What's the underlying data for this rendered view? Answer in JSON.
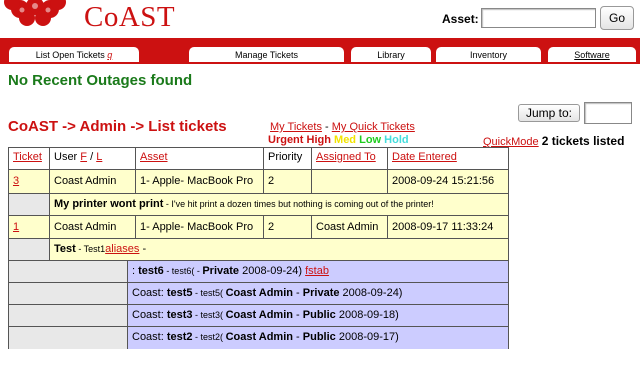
{
  "app": {
    "title": "CoAST",
    "logo": "flower-logo"
  },
  "asset_search": {
    "label": "Asset:",
    "value": "",
    "go_label": "Go"
  },
  "nav": {
    "tabs": [
      {
        "label": "List Open Tickets",
        "hotkey": "q"
      },
      {
        "label": "Manage Tickets"
      },
      {
        "label": "Library"
      },
      {
        "label": "Inventory"
      },
      {
        "label": "Software"
      }
    ]
  },
  "outages_text": "No Recent Outages found",
  "jump": {
    "label": "Jump to:",
    "value": ""
  },
  "breadcrumb": "CoAST -> Admin -> List tickets",
  "links": {
    "my_tickets": "My Tickets",
    "separator": " - ",
    "my_quick_tickets": "My Quick Tickets"
  },
  "priority_legend": {
    "urgent": "Urgent",
    "high": "High",
    "med": "Med",
    "low": "Low",
    "hold": "Hold"
  },
  "quickmode": {
    "label": "QuickMode",
    "count_text": "2 tickets listed"
  },
  "table": {
    "headers": {
      "ticket": "Ticket",
      "user": "User",
      "user_f": "F",
      "user_sep": " / ",
      "user_l": "L",
      "asset": "Asset",
      "priority": "Priority",
      "assigned_to": "Assigned To",
      "date_entered": "Date Entered"
    },
    "tickets": [
      {
        "id": "3",
        "user": "Coast Admin",
        "asset": "1- Apple- MacBook Pro",
        "priority": "2",
        "assigned_to": "",
        "date": "2008-09-24 15:21:56",
        "title": "My printer wont print",
        "description": " - I've hit print a dozen times but nothing is coming out of the printer!"
      },
      {
        "id": "1",
        "user": "Coast Admin",
        "asset": "1- Apple- MacBook Pro",
        "priority": "2",
        "assigned_to": "Coast Admin",
        "date": "2008-09-17 11:33:24",
        "title": "Test",
        "description_prefix": " - Test1",
        "description_link": "aliases",
        "description_suffix": " -",
        "subtickets": [
          {
            "prefix": ": ",
            "name": "test6",
            "short": " - test6( - ",
            "owner": "",
            "visibility": "Private",
            "date": " 2008-09-24)",
            "link": "fstab"
          },
          {
            "prefix": "Coast: ",
            "name": "test5",
            "short": " - test5( ",
            "owner": "Coast Admin",
            "visibility": "Private",
            "date": " 2008-09-24)"
          },
          {
            "prefix": "Coast: ",
            "name": "test3",
            "short": " - test3( ",
            "owner": "Coast Admin",
            "visibility": "Public",
            "date": " 2008-09-18)"
          },
          {
            "prefix": "Coast: ",
            "name": "test2",
            "short": " - test2( ",
            "owner": "Coast Admin",
            "visibility": "Public",
            "date": " 2008-09-17)"
          }
        ]
      }
    ]
  },
  "colors": {
    "brand_red": "#cc1111",
    "outage_green": "#1a7a1a",
    "ticket_yellow": "#ffffcc",
    "subticket_blue": "#ccccff"
  }
}
